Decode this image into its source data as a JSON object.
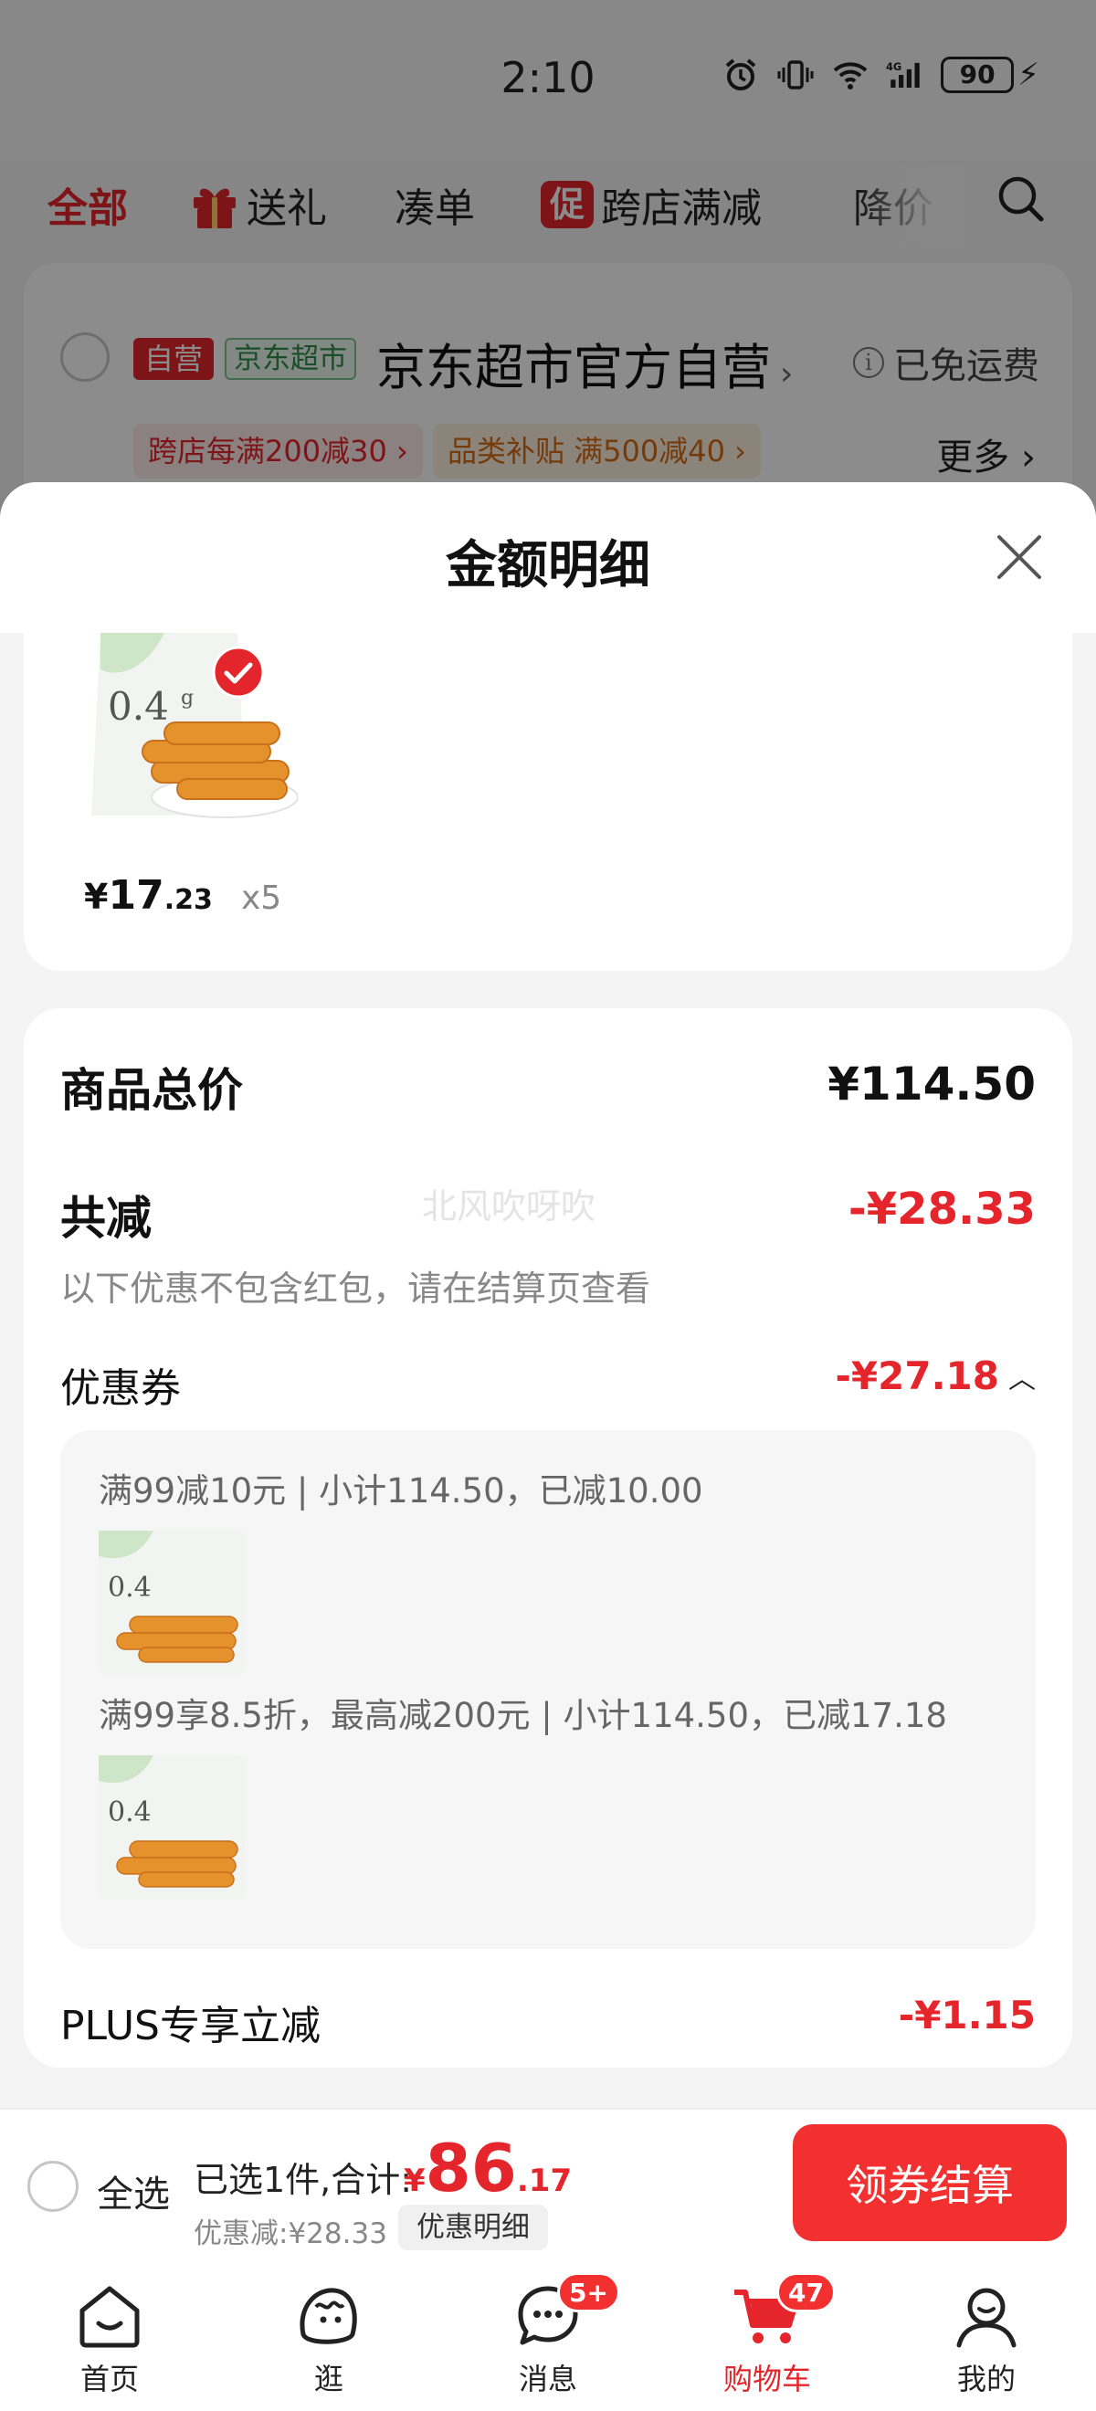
{
  "status": {
    "time": "2:10",
    "network": "4G",
    "battery": "90"
  },
  "top_tabs": [
    {
      "label": "全部"
    },
    {
      "label": "送礼"
    },
    {
      "label": "凑单"
    },
    {
      "label": "跨店满减",
      "badge": "促"
    },
    {
      "label": "降价"
    }
  ],
  "store": {
    "badge_self": "自营",
    "badge_market": "京东超市",
    "name": "京东超市官方自营",
    "shipping": "已免运费",
    "promo1": "跨店每满200减30 ›",
    "promo2": "品类补贴 满500减40 ›",
    "more": "更多 ›"
  },
  "sheet": {
    "title": "金额明细",
    "product": {
      "price_currency": "¥",
      "price_int": "17",
      "price_dec": ".23",
      "qty": "x5"
    },
    "summary": {
      "total_label": "商品总价",
      "total_value": "¥114.50",
      "reduce_label": "共减",
      "reduce_value": "-¥28.33",
      "note": "以下优惠不包含红包，请在结算页查看",
      "watermark": "北风吹呀吹",
      "coupon_label": "优惠券",
      "coupon_value": "-¥27.18",
      "coupon_lines": [
        "满99减10元 | 小计114.50，已减10.00",
        "满99享8.5折，最高减200元 | 小计114.50，已减17.18"
      ],
      "plus_label": "PLUS专享立减",
      "plus_value": "-¥1.15"
    }
  },
  "checkout": {
    "select_all": "全选",
    "selected": "已选1件,合计:",
    "total_currency": "¥",
    "total_int": "86",
    "total_dec": ".17",
    "discount": "优惠减:¥28.33",
    "detail_chip": "优惠明细",
    "button": "领券结算"
  },
  "tabbar": [
    {
      "label": "首页"
    },
    {
      "label": "逛"
    },
    {
      "label": "消息",
      "badge": "5+"
    },
    {
      "label": "购物车",
      "badge": "47"
    },
    {
      "label": "我的"
    }
  ],
  "colors": {
    "accent": "#e4262c",
    "button": "#f23030"
  }
}
